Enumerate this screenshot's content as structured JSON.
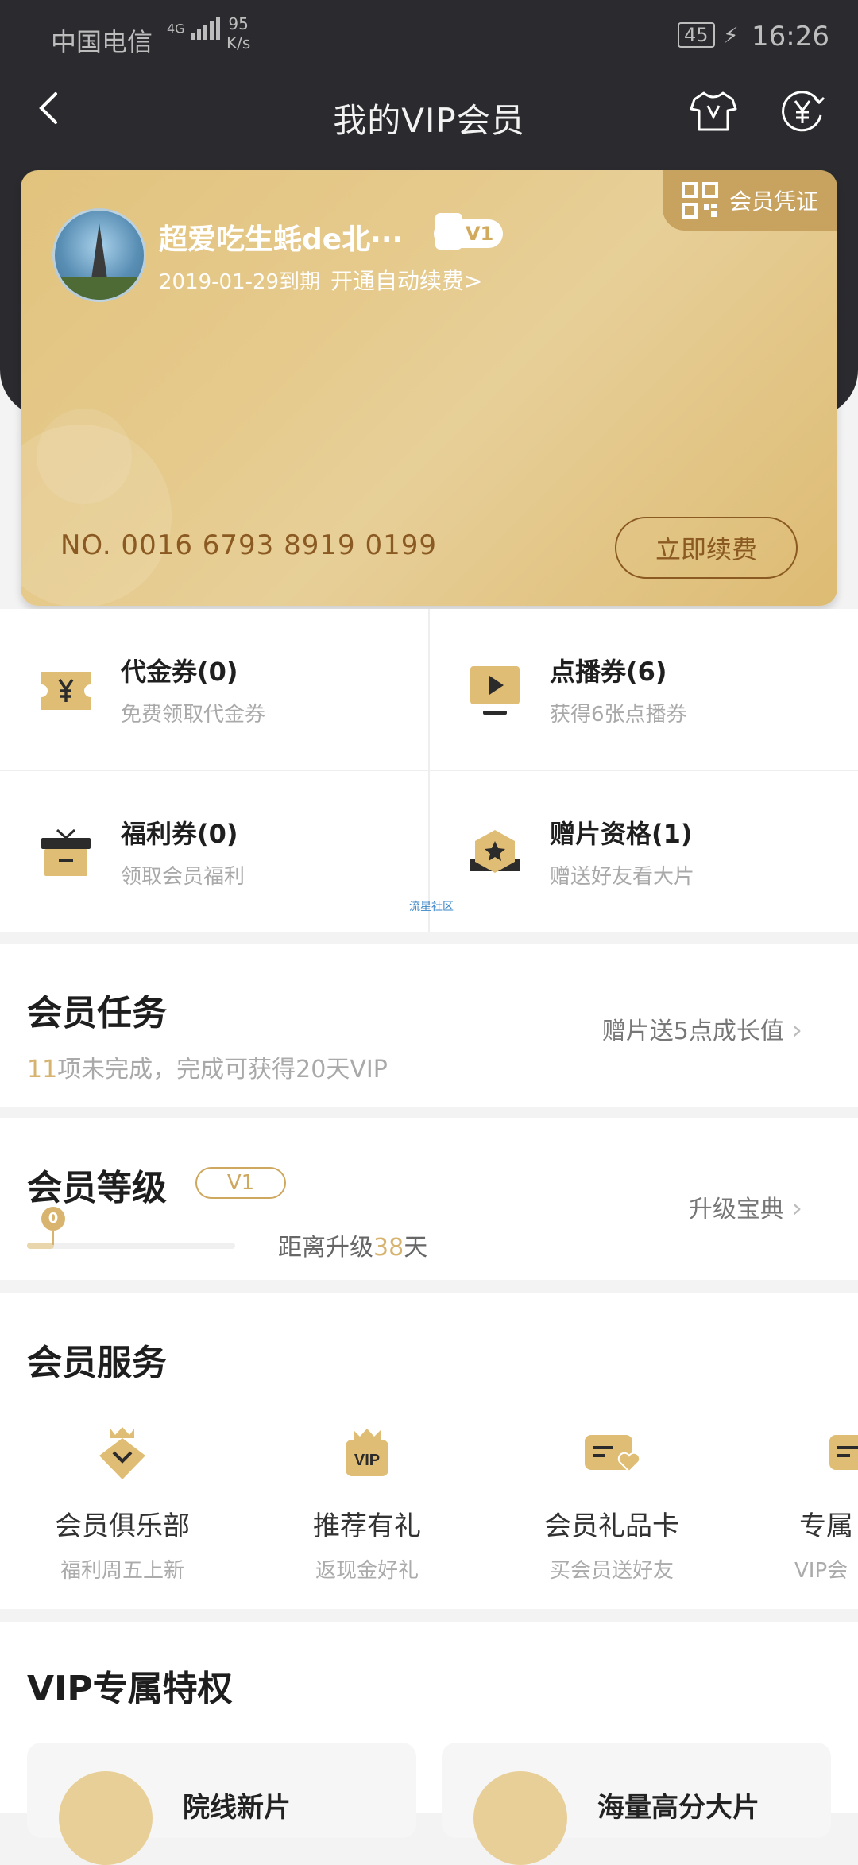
{
  "status_bar": {
    "carrier": "中国电信",
    "network": "4G",
    "speed_value": "95",
    "speed_unit": "K/s",
    "battery": "45",
    "time": "16:26"
  },
  "nav": {
    "title": "我的VIP会员"
  },
  "card": {
    "cert_label": "会员凭证",
    "user_name": "超爱吃生蚝de北···",
    "level": "V1",
    "expire": "2019-01-29到期",
    "auto_renew": "开通自动续费>",
    "card_no": "NO. 0016 6793 8919 0199",
    "renew_button": "立即续费"
  },
  "coupons": [
    {
      "title": "代金券(0)",
      "sub": "免费领取代金券",
      "icon": "yuan-ticket-icon"
    },
    {
      "title": "点播券(6)",
      "sub": "获得6张点播券",
      "icon": "play-ticket-icon"
    },
    {
      "title": "福利券(0)",
      "sub": "领取会员福利",
      "icon": "gift-box-icon"
    },
    {
      "title": "赠片资格(1)",
      "sub": "赠送好友看大片",
      "icon": "star-badge-icon"
    }
  ],
  "watermark": "流星社区",
  "tasks": {
    "title": "会员任务",
    "count": "11",
    "sub_rest": "项未完成，完成可获得20天VIP",
    "right": "赠片送5点成长值"
  },
  "level": {
    "title": "会员等级",
    "pill": "V1",
    "progress_value": "0",
    "days_prefix": "距离升级",
    "days": "38",
    "days_suffix": "天",
    "right": "升级宝典"
  },
  "services": {
    "title": "会员服务",
    "items": [
      {
        "label": "会员俱乐部",
        "sub": "福利周五上新",
        "icon": "crown-down-icon"
      },
      {
        "label": "推荐有礼",
        "sub": "返现金好礼",
        "icon": "vip-crown-icon"
      },
      {
        "label": "会员礼品卡",
        "sub": "买会员送好友",
        "icon": "gift-card-icon"
      },
      {
        "label": "专属",
        "sub": "VIP会",
        "icon": "card-icon"
      }
    ]
  },
  "privileges": {
    "title": "VIP专属特权",
    "items": [
      {
        "label": "院线新片"
      },
      {
        "label": "海量高分大片"
      }
    ]
  },
  "colors": {
    "header_bg": "#2b2b2f",
    "gold": "#d6b36f",
    "card_text": "#8a5a22"
  }
}
